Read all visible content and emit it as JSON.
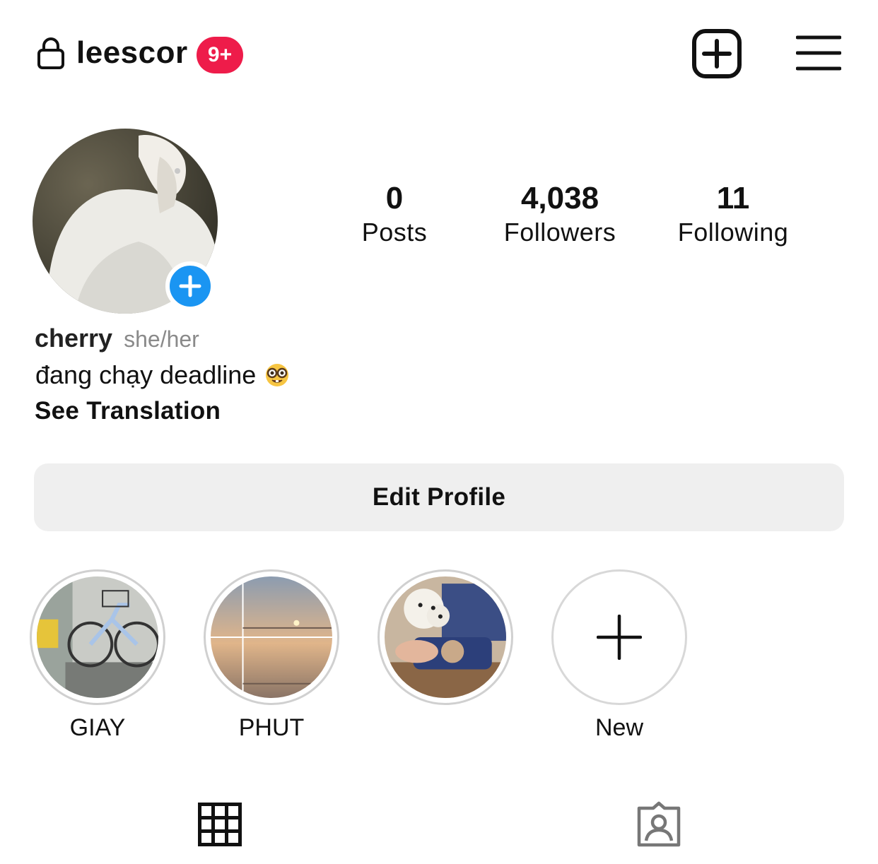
{
  "header": {
    "username": "leescor",
    "notification_badge": "9+",
    "lock_icon": "lock-icon",
    "new_post_icon": "plus-square-icon",
    "menu_icon": "hamburger-menu-icon",
    "badge_color": "#ee1c4a"
  },
  "profile": {
    "add_story_icon": "plus-icon",
    "add_story_color": "#1a95f2"
  },
  "stats": [
    {
      "value": "0",
      "label": "Posts"
    },
    {
      "value": "4,038",
      "label": "Followers"
    },
    {
      "value": "11",
      "label": "Following"
    }
  ],
  "bio": {
    "name": "cherry",
    "pronouns": "she/her",
    "text": "đang chạy deadline",
    "emoji": "nerd-face-emoji",
    "see_translation": "See Translation"
  },
  "edit_profile_label": "Edit Profile",
  "highlights": [
    {
      "label": "GIAY"
    },
    {
      "label": "PHUT"
    },
    {
      "label": ""
    },
    {
      "label": "New"
    }
  ],
  "tabs": {
    "grid_icon": "grid-icon",
    "tagged_icon": "tagged-person-icon"
  }
}
